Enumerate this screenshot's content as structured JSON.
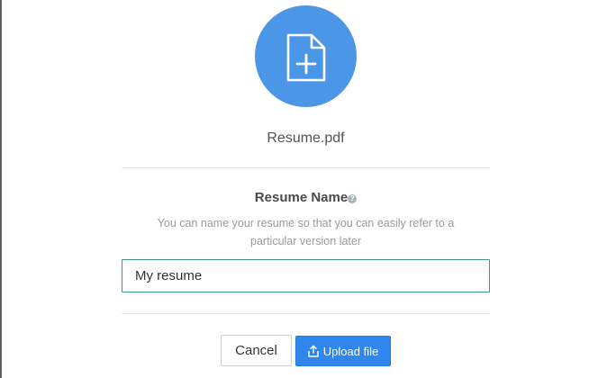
{
  "file": {
    "icon": "file-plus-icon",
    "name": "Resume.pdf"
  },
  "form": {
    "title": "Resume Name",
    "help_icon": "?",
    "help_text": "You can name your resume so that you can easily refer to a particular version later",
    "name_value": "My resume"
  },
  "actions": {
    "cancel_label": "Cancel",
    "upload_label": "Upload file",
    "upload_icon": "upload-icon"
  },
  "colors": {
    "accent": "#4c96e8",
    "primary_button": "#2f86eb",
    "input_border": "#3a968b"
  }
}
